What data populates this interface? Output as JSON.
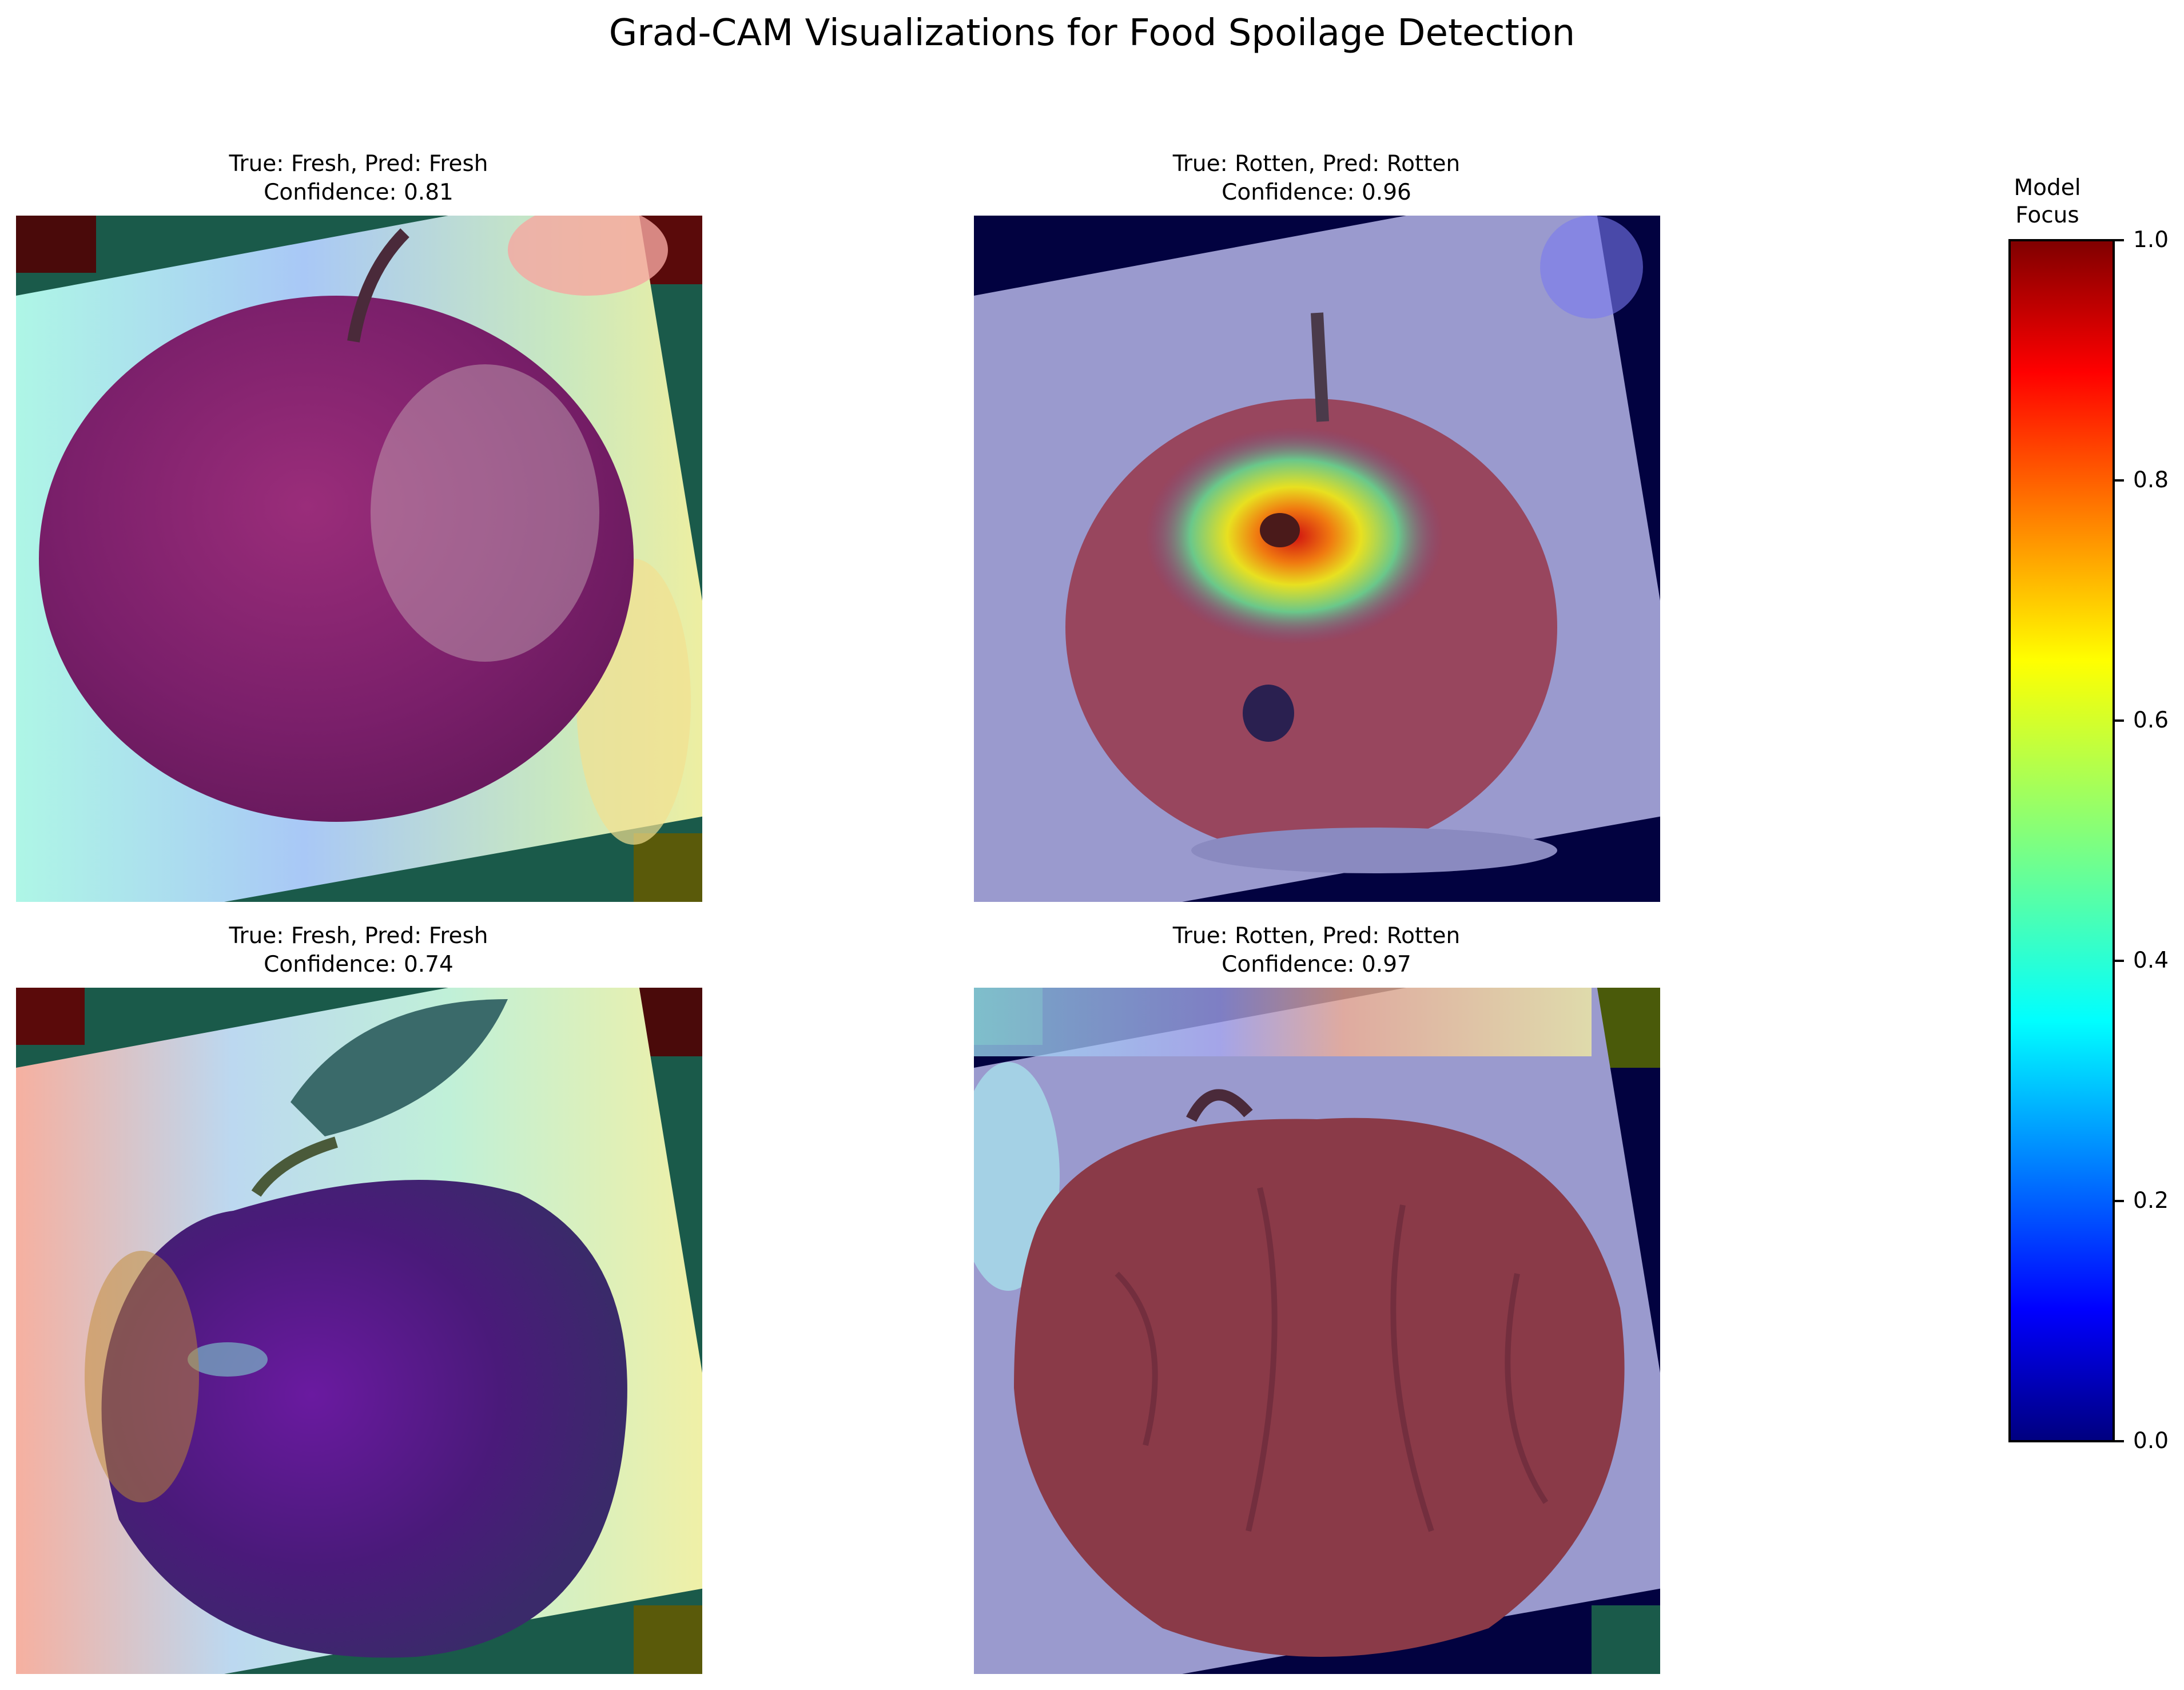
{
  "chart_data": {
    "type": "heatmap",
    "title": "Grad-CAM Visualizations for Food Spoilage Detection",
    "colormap": "jet",
    "panels": [
      {
        "true_label": "Fresh",
        "pred_label": "Fresh",
        "confidence": 0.81,
        "title_line1": "True: Fresh, Pred: Fresh",
        "title_line2": "Confidence: 0.81",
        "condition": "fresh",
        "focus": "background"
      },
      {
        "true_label": "Rotten",
        "pred_label": "Rotten",
        "confidence": 0.96,
        "title_line1": "True: Rotten, Pred: Rotten",
        "title_line2": "Confidence: 0.96",
        "condition": "rotten-bruised",
        "focus": "bruise spot"
      },
      {
        "true_label": "Fresh",
        "pred_label": "Fresh",
        "confidence": 0.74,
        "title_line1": "True: Fresh, Pred: Fresh",
        "title_line2": "Confidence: 0.74",
        "condition": "fresh-with-leaf",
        "focus": "background"
      },
      {
        "true_label": "Rotten",
        "pred_label": "Rotten",
        "confidence": 0.97,
        "title_line1": "True: Rotten, Pred: Rotten",
        "title_line2": "Confidence: 0.97",
        "condition": "rotten-wrinkled",
        "focus": "top background"
      }
    ],
    "colorbar": {
      "label_line1": "Model",
      "label_line2": "Focus",
      "range": [
        0.0,
        1.0
      ],
      "ticks": [
        "0.0",
        "0.2",
        "0.4",
        "0.6",
        "0.8",
        "1.0"
      ]
    }
  }
}
